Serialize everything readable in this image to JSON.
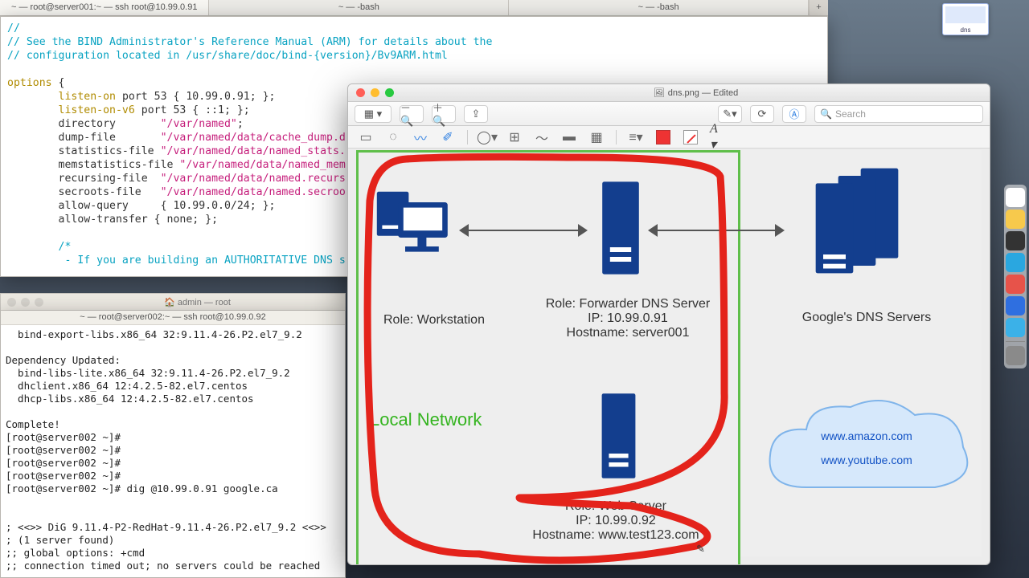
{
  "tabs": {
    "t1": "~ — root@server001:~ — ssh root@10.99.0.91",
    "t2": "~ — -bash",
    "t3": "~ — -bash"
  },
  "editor": {
    "l1": "//",
    "l2": "// See the BIND Administrator's Reference Manual (ARM) for details about the",
    "l3": "// configuration located in /usr/share/doc/bind-{version}/Bv9ARM.html",
    "kw_opt": "options",
    "brace": " {",
    "kw_listen": "listen-on",
    "listen_rest": " port 53 { 10.99.0.91; };",
    "kw_listen6": "listen-on-v6",
    "listen6_rest": " port 53 { ::1; };",
    "dir_k": "directory       ",
    "dir_v": "\"/var/named\"",
    "dump_k": "dump-file       ",
    "dump_v": "\"/var/named/data/cache_dump.d",
    "stat_k": "statistics-file ",
    "stat_v": "\"/var/named/data/named_stats.",
    "mem_k": "memstatistics-file ",
    "mem_v": "\"/var/named/data/named_mem",
    "rec_k": "recursing-file  ",
    "rec_v": "\"/var/named/data/named.recurs",
    "sec_k": "secroots-file   ",
    "sec_v": "\"/var/named/data/named.secroo",
    "aq_k": "allow-query     { 10.99.0.0/24; };",
    "at_k": "allow-transfer { none; };",
    "cm_open": "/*",
    "cm_line": " - If you are building an AUTHORITATIVE DNS s"
  },
  "lowtitle": "admin — root",
  "lowtab": "~ — root@server002:~ — ssh root@10.99.0.92",
  "low": {
    "l1": "  bind-export-libs.x86_64 32:9.11.4-26.P2.el7_9.2",
    "l2": "",
    "l3": "Dependency Updated:",
    "l4": "  bind-libs-lite.x86_64 32:9.11.4-26.P2.el7_9.2",
    "l5": "  dhclient.x86_64 12:4.2.5-82.el7.centos",
    "l6": "  dhcp-libs.x86_64 12:4.2.5-82.el7.centos",
    "l7": "",
    "l8": "Complete!",
    "l9": "[root@server002 ~]#",
    "l10": "[root@server002 ~]#",
    "l11": "[root@server002 ~]#",
    "l12": "[root@server002 ~]#",
    "l13": "[root@server002 ~]# dig @10.99.0.91 google.ca",
    "l14": "",
    "l15": "",
    "l16": "; <<>> DiG 9.11.4-P2-RedHat-9.11.4-26.P2.el7_9.2 <<>>",
    "l17": "; (1 server found)",
    "l18": ";; global options: +cmd",
    "l19": ";; connection timed out; no servers could be reached"
  },
  "preview": {
    "title": "dns.png — Edited",
    "search_ph": "Search",
    "workstation": "Role: Workstation",
    "fwd1": "Role: Forwarder DNS Server",
    "fwd2": "IP: 10.99.0.91",
    "fwd3": "Hostname: server001",
    "google": "Google's DNS Servers",
    "local": "Local Network",
    "web1": "Role: Web Server",
    "web2": "IP: 10.99.0.92",
    "web3": "Hostname: www.test123.com",
    "cloud1": "www.amazon.com",
    "cloud2": "www.youtube.com"
  },
  "thumb_caption": "dns"
}
